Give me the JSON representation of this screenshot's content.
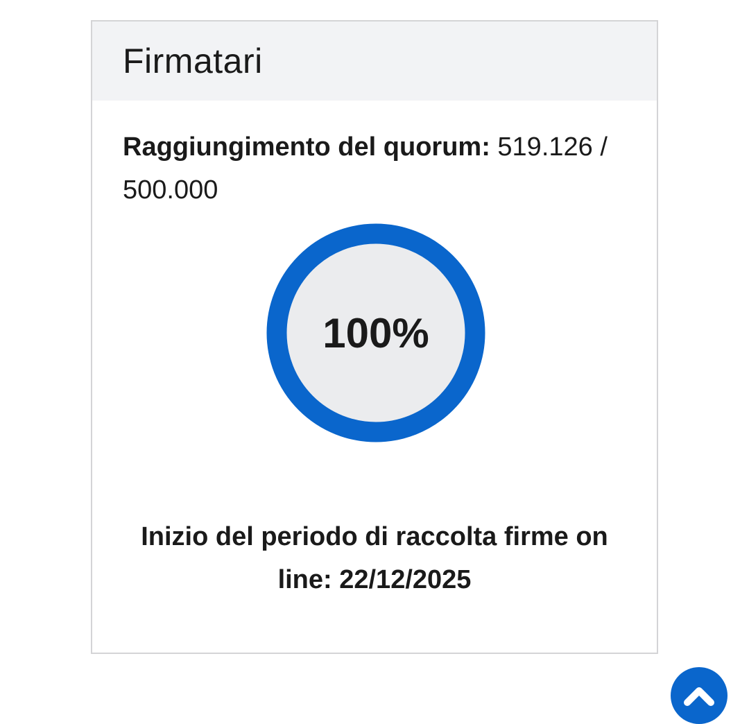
{
  "card": {
    "title": "Firmatari",
    "quorum_label": "Raggiungimento del quorum:",
    "quorum_value": " 519.126 / 500.000",
    "progress_percent_label": "100%",
    "progress_fraction": 1.0,
    "start_date_text": "Inizio del periodo di raccolta firme on line: 22/12/2025"
  },
  "colors": {
    "accent": "#0a66cc",
    "ring_inner": "#ebecee",
    "header_bg": "#f2f3f5",
    "border": "#d4d4d6"
  },
  "icons": {
    "back_to_top": "chevron-up-icon"
  }
}
